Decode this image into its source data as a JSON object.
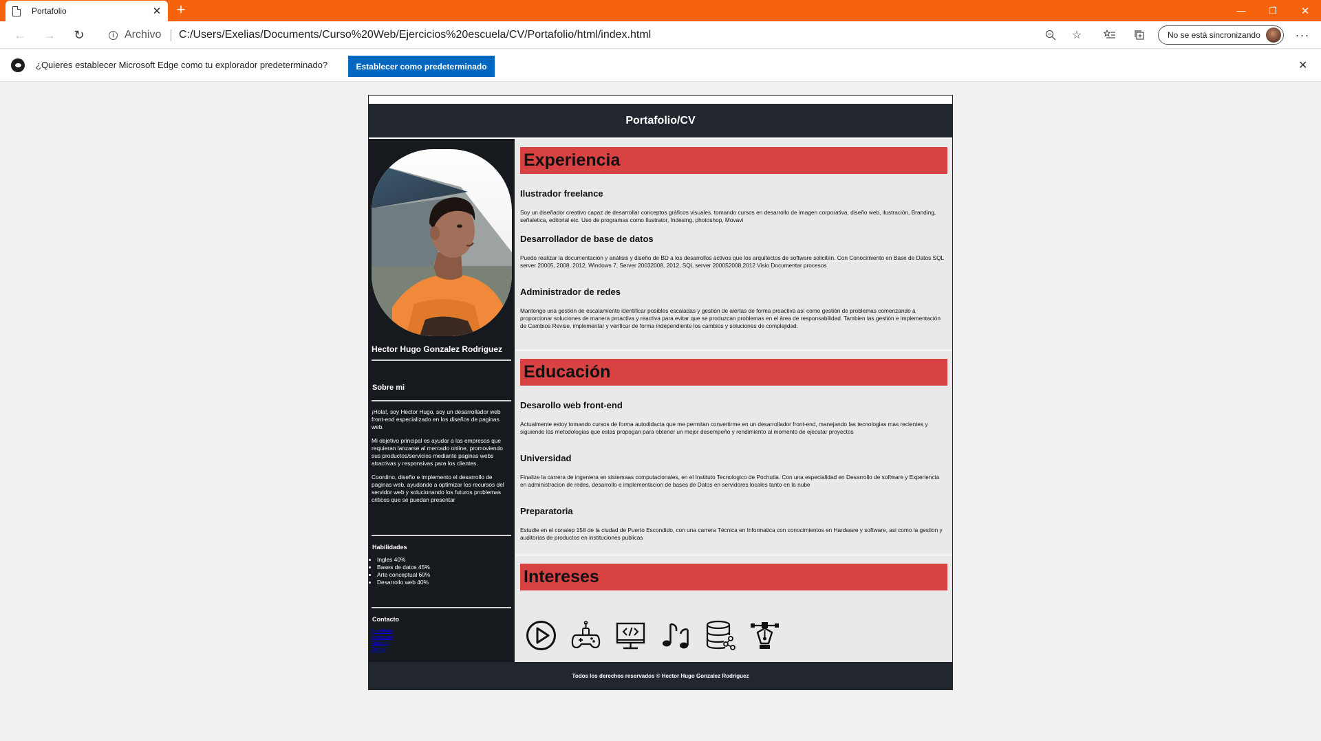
{
  "browser": {
    "tab_title": "Portafolio",
    "site_label": "Archivo",
    "url": "C:/Users/Exelias/Documents/Curso%20Web/Ejercicios%20escuela/CV/Portafolio/html/index.html",
    "sync_label": "No se está sincronizando",
    "accent_color": "#f7630c"
  },
  "infobar": {
    "message": "¿Quieres establecer Microsoft Edge como tu explorador predeterminado?",
    "button_label": "Establecer como predeterminado"
  },
  "header": {
    "title": "Portafolio/CV"
  },
  "sidebar": {
    "name": "Hector Hugo Gonzalez Rodriguez",
    "about_title": "Sobre mi",
    "about_paragraphs": [
      "¡Hola!, soy Hector Hugo, soy un desarrollador web front-end especializado en los diseños de paginas web.",
      "Mi objetivo principal es ayudar a las empresas que requieran lanzarse al mercado online, promoviendo sus productos/servicios mediante paginas webs atractivas y responsivas para los clientes.",
      "Coordino, diseño e implemento el desarrollo de paginas web, ayudando a optimizar los recursos del servidor web y solucionando los futuros problemas criticos que se puedan presentar"
    ],
    "skills_title": "Habilidades",
    "skills": [
      "Ingles 40%",
      "Bases de datos 45%",
      "Arte conceptual 60%",
      "Desarrollo web 40%"
    ],
    "contact_title": "Contacto",
    "contact_links": [
      "Facebook",
      "Instagram",
      "Linkedin",
      "Twitter"
    ]
  },
  "sections": {
    "experience": {
      "title": "Experiencia",
      "items": [
        {
          "title": "Ilustrador freelance",
          "text": "Soy un diseñador creativo capaz de desarrollar conceptos gráficos visuales. tomando cursos en desarrollo de imagen corporativa, diseño web, ilustración, Branding, señaletica, editorial etc. Uso de programas como Ilustrator, Indesing, photoshop, Movavi"
        },
        {
          "title": "Desarrollador de base de datos",
          "text": "Puedo realizar la documentación y análisis y diseño de BD a los desarrollos activos que los arquitectos de software soliciten. Con Conocimiento en Base de Datos SQL server 20005, 2008, 2012, Windows 7, Server 20032008, 2012, SQL server 200052008,2012 Visio Documentar procesos"
        },
        {
          "title": "Administrador de redes",
          "text": "Mantengo una gestión de escalamiento identificar posibles escaladas y gestión de alertas de forma proactiva así como gestión de problemas comenzando a proporcionar soluciones de manera proactiva y reactiva para evitar que se produzcan problemas en el área de responsabilidad. Tambien las gestión e implementación de Cambios Revise, implementar y verificar de forma independiente los cambios y soluciones de complejidad."
        }
      ]
    },
    "education": {
      "title": "Educación",
      "items": [
        {
          "title": "Desarollo web front-end",
          "text": "Actualmente estoy tomando cursos de forma autodidacta que me permitan convertirme en un desarrollador front-end, manejando las tecnologias mas recientes y siguiendo las metodologias que estas propogan para obtener un mejor desempeño y rendimiento al momento de ejecutar proyectos"
        },
        {
          "title": "Universidad",
          "text": "Finalize la carrera de ingeniera en sistemaas computacionales, en el Instituto Tecnologico de Pochutla. Con una especialidad en Desarrollo de software y Experiencia en administracion de redes, desarrollo e implementacion de bases de Datos en servidores locales tanto en la nube"
        },
        {
          "title": "Preparatoria",
          "text": "Estudie en el conalep 158 de la ciudad de Puerto Escondido, con una carrera Técnica en Informatica con conocimientos en Hardware y software, asi como la gestion y auditorias de productos en instituciones publicas"
        }
      ]
    },
    "interests": {
      "title": "Intereses",
      "icons": [
        "play-icon",
        "gamepad-icon",
        "code-monitor-icon",
        "music-note-icon",
        "database-icon",
        "pen-tool-icon"
      ]
    }
  },
  "footer": {
    "text": "Todos los derechos reservados © Hector Hugo Gonzalez Rodriguez"
  },
  "colors": {
    "header_bg": "#22262e",
    "sidebar_bg": "#161a1f",
    "main_bg": "#e9e9e9",
    "section_title_bg": "#d84242",
    "edge_button": "#0067c0"
  }
}
